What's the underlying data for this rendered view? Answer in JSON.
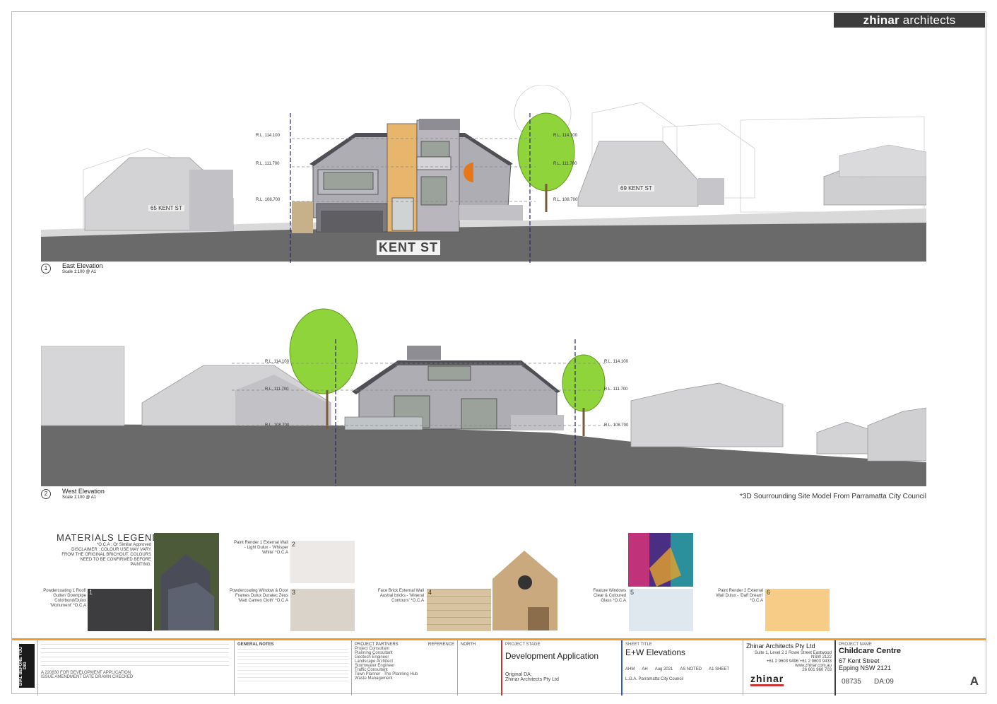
{
  "brand": {
    "bold": "zhinar",
    "rest": " architects"
  },
  "east": {
    "num": "1",
    "title": "East Elevation",
    "scale": "Scale 1:100 @ A1",
    "street": "KENT ST",
    "neighbour_left": "65 KENT ST",
    "neighbour_right": "69 KENT ST",
    "rl": [
      "R.L. 114.100",
      "R.L. 111.700",
      "R.L. 108.700"
    ]
  },
  "west": {
    "num": "2",
    "title": "West Elevation",
    "scale": "Scale 1:100 @ A1",
    "rl": [
      "R.L. 114.100",
      "R.L. 111.700",
      "R.L. 108.700"
    ]
  },
  "site_note": "*3D Sourrounding Site Model From Parramatta City Council",
  "legend": {
    "title": "MATERIALS   LEGEND",
    "sub": "*O.C.A : Or Similar Approved",
    "disclaimer": "DISCLAIMER : COLOUR USE MAY VARY FROM THE ORIGINAL BRICHOUT. COLOURS NEED TO BE CONFIRMED BEFORE PAINTING.",
    "items": [
      {
        "num": "1",
        "label": "Powdercoating 1 Roof/ Gutter/ Downpipe Colorbond/Dulux 'Monument' *O.C.A",
        "color": "#3d3d3f"
      },
      {
        "num": "2",
        "label": "Paint Render 1 External Wall - Light Dulux - 'Whisper White' *O.C.A",
        "color": "#ede9e6"
      },
      {
        "num": "3",
        "label": "Powdercoating Window & Door Frames Dulux Duratec Zeus 'Matt Cameo Cloth' *O.C.A",
        "color": "#d9d3ca"
      },
      {
        "num": "4",
        "label": "Face Brick External Wall Austral bricks - 'Mineral Contours' *O.C.A",
        "color": "#d8c3a0"
      },
      {
        "num": "5",
        "label": "Feature Windows Clear & Coloured Glass *O.C.A",
        "color": "#dfe8ee"
      },
      {
        "num": "6",
        "label": "Paint Render 2 External Wall Dulux - 'Daff Dream' *O.C.A",
        "color": "#f6cc86"
      }
    ]
  },
  "titleblock": {
    "dbyd": "DIAL BEFORE YOU DIG",
    "rev_row": "A   220830 FOR DEVELOPMENT APPLICATION",
    "rev_headers": "ISSUE   AMENDMENT   DATE   DRAWN   CHECKED",
    "general_notes_title": "GENERAL NOTES",
    "partners_title": "PROJECT PARTNERS",
    "reference_title": "REFERENCE",
    "north_title": "NORTH",
    "partners": [
      "Project Consultant",
      "Planning Consultant",
      "Geotech Engineer",
      "Landscape Architect",
      "Stormwater Engineer",
      "Traffic Consultant",
      "Town Planner",
      "Waste Management"
    ],
    "partner_ref": "The Planning Hub",
    "project_stage_label": "PROJECT STAGE",
    "project_stage": "Development Application",
    "original_da": "Original DA:",
    "original_da_by": "Zhinar Architects Pty Ltd",
    "sheet_title_label": "SHEET TITLE",
    "sheet_title": "E+W Elevations",
    "designed": "AHM",
    "drawn": "AH",
    "commenced": "Aug 2021",
    "scale": "AS NOTED",
    "print": "A1 SHEET",
    "lga": "L.G.A.   Parramatta City Council",
    "firm": "Zhinar Architects Pty Ltd",
    "firm_addr": "Suite 1, Level 2 2 Rowe Street Eastwood NSW 2122",
    "firm_phone": "+61 2 9603 9496 +61 2 9603 9433",
    "firm_web": "www.zhinar.com.au",
    "firm_abn": "26 601 960 703",
    "firm_logo": "zhinar",
    "project_label": "PROJECT NAME",
    "project": "Childcare Centre",
    "address1": "67 Kent Street",
    "address2": "Epping NSW 2121",
    "job_no": "08735",
    "drawing_no": "DA:09",
    "rev": "A"
  }
}
